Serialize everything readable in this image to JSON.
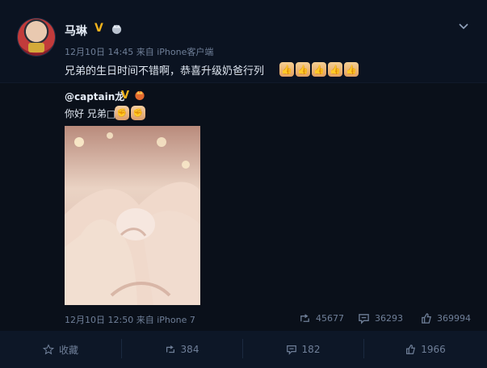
{
  "post": {
    "author": "马琳",
    "time": "12月10日 14:45",
    "source_prefix": "来自",
    "source": "iPhone客户端",
    "text": "兄弟的生日时间不错啊，恭喜升级奶爸行列",
    "text_emoji": "thumbs-up",
    "text_emoji_count": 5
  },
  "repost": {
    "author": "@captain龙",
    "text": "你好 兄弟□",
    "text_emoji": "fist",
    "text_emoji_count": 2,
    "time": "12月10日 12:50",
    "source_prefix": "来自",
    "source": "iPhone 7",
    "stats": {
      "reposts": "45677",
      "comments": "36293",
      "likes": "369994"
    }
  },
  "footer": {
    "favorite": "收藏",
    "reposts": "384",
    "comments": "182",
    "likes": "1966"
  },
  "colors": {
    "background": "#0b1321",
    "repost_background": "#0a101a",
    "verified": "#f0b21c",
    "muted_text": "#6f7f98"
  }
}
